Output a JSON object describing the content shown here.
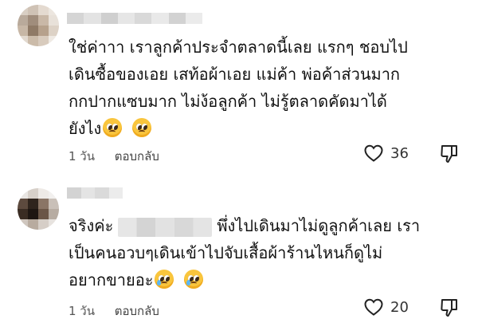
{
  "comments": [
    {
      "lines": [
        "ใช่ค่าาา เราลูกค้าประจำตลาดนี้เลย แรกๆ ชอบไป",
        "เดินซื้อของเอย เสท้อผ้าเอย แม่ค้า พ่อค้าส่วนมาก",
        "กกปากแซบมาก ไม่ง้อลูกค้า ไม่รู้ตลาดคัดมาได้",
        "ยังไง"
      ],
      "emojis": [
        "pleading-face-emoji",
        "pleading-face-emoji"
      ],
      "time": "1 วัน",
      "reply_label": "ตอบกลับ",
      "like_count": "36"
    },
    {
      "line1_prefix": "จริงค่ะ",
      "line1_suffix": "พึ่งไปเดินมาไม่ดูลูกค้าเลย เรา",
      "lines_rest": [
        "เป็นคนอวบๆเดินเข้าไปจับเสื้อผ้าร้านไหนก็ดูไม่",
        "อยากขายอะ"
      ],
      "emojis": [
        "crying-face-emoji",
        "crying-face-emoji"
      ],
      "time": "1 วัน",
      "reply_label": "ตอบกลับ",
      "like_count": "20"
    }
  ],
  "icons": {
    "like": "heart-outline-icon",
    "dislike": "thumbs-down-outline-icon"
  },
  "colors": {
    "text": "#111111",
    "meta": "#555555",
    "emoji_face": "#f9c53d",
    "tear": "#5bb6f2"
  }
}
